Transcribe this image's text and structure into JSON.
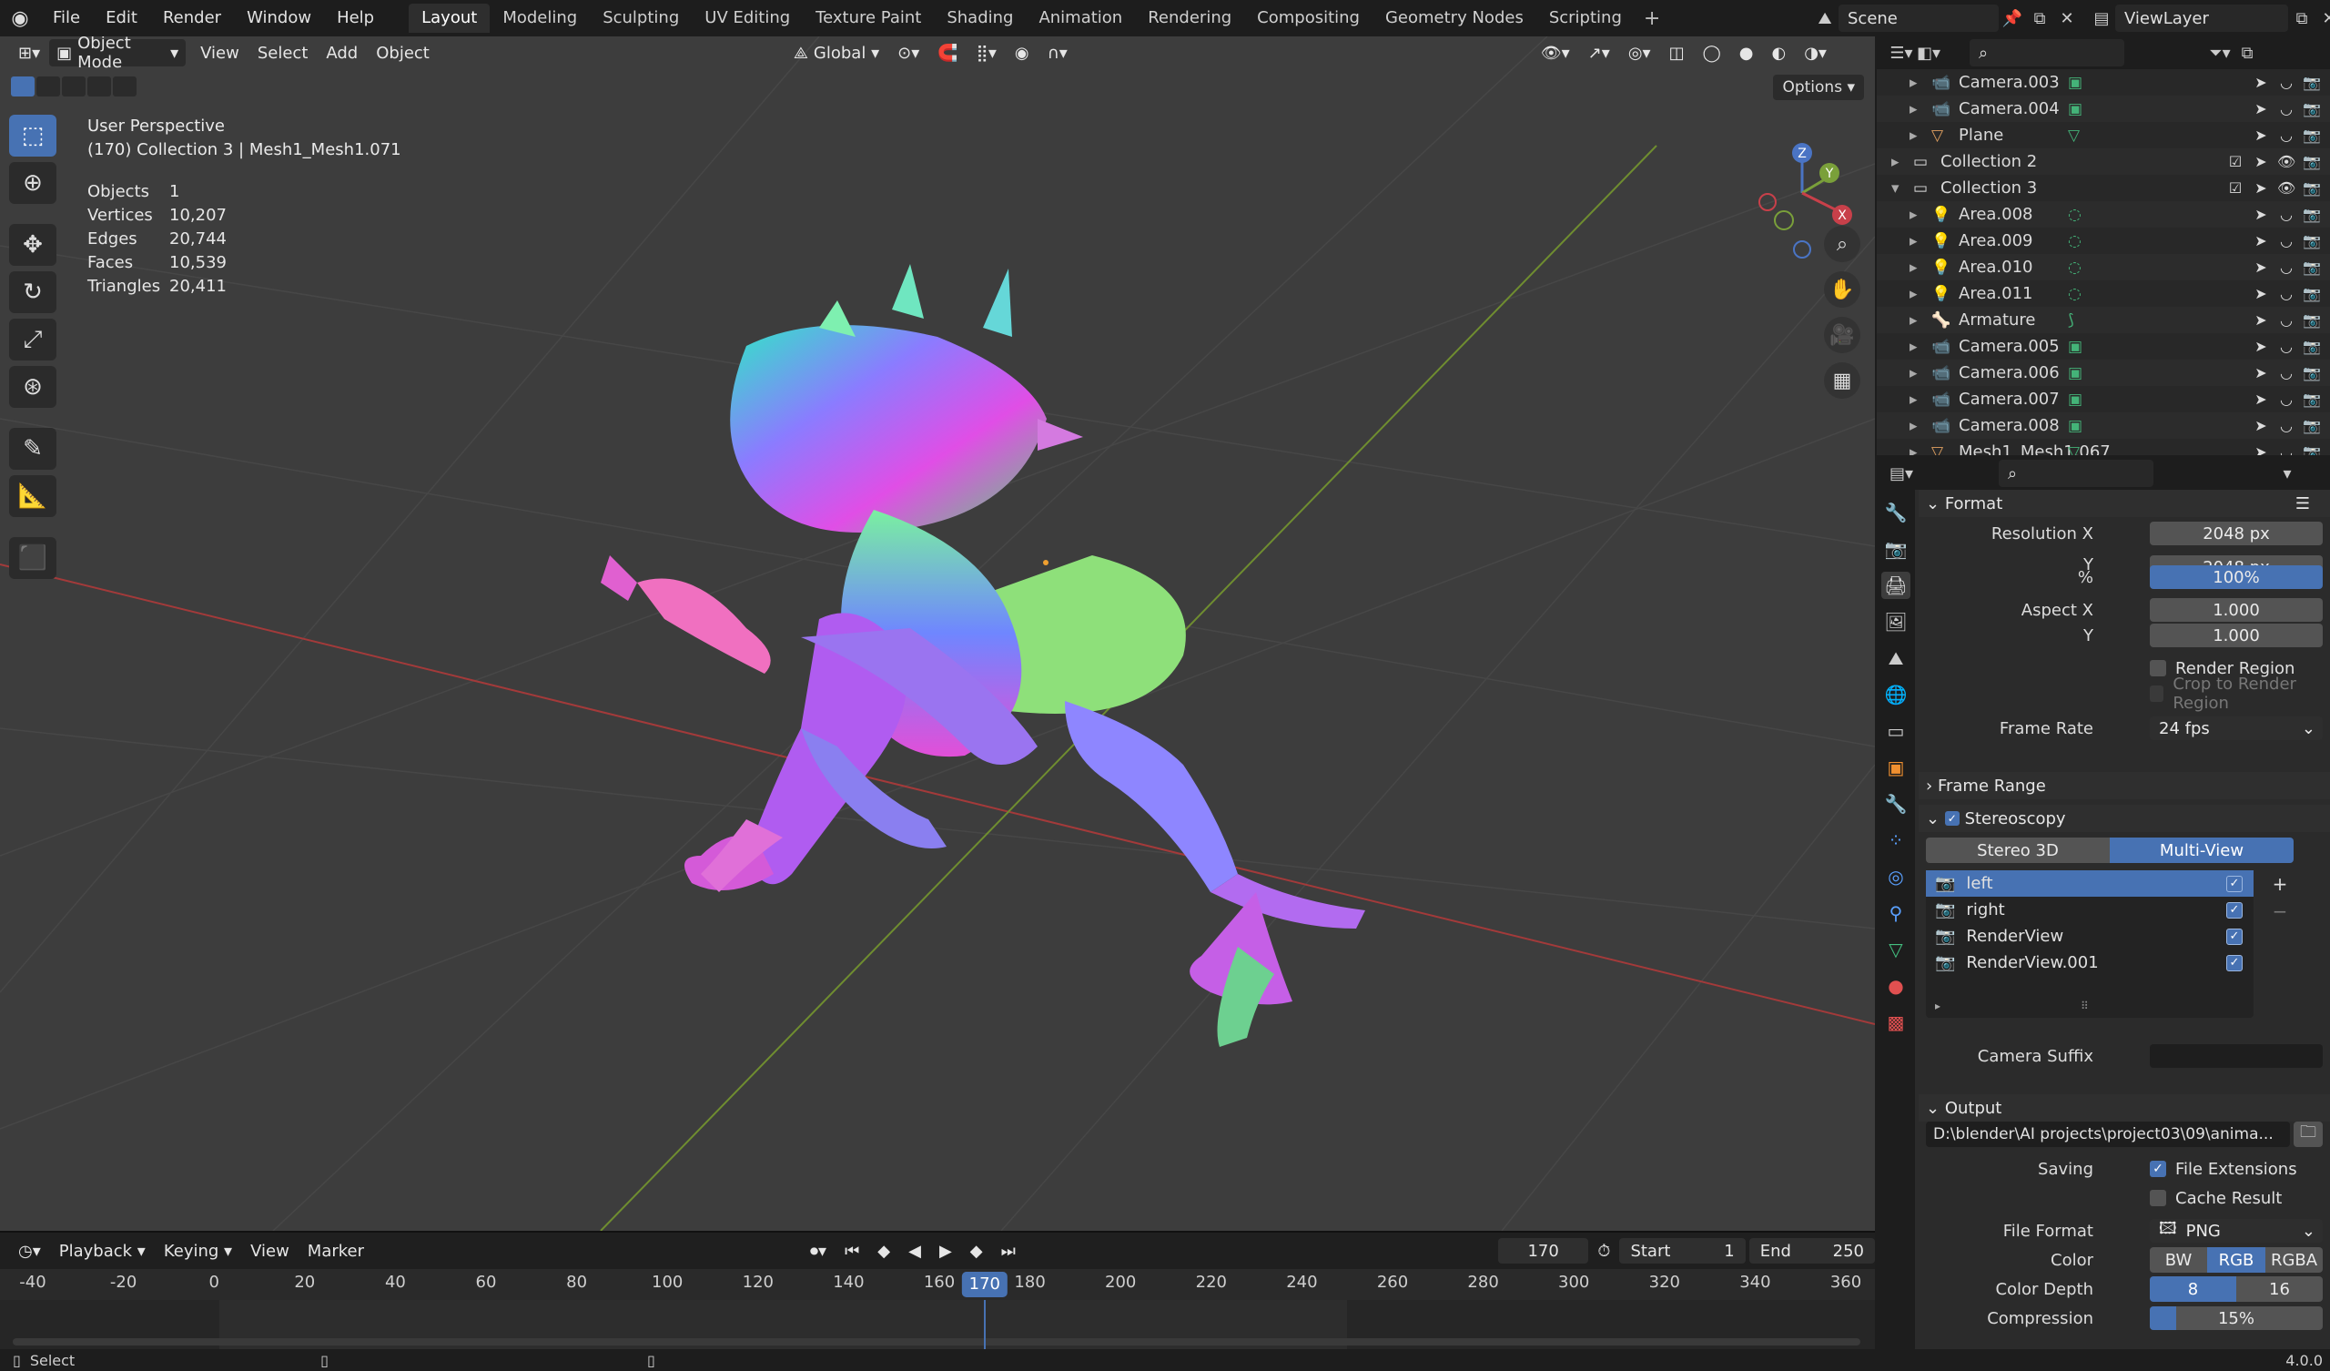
{
  "menu": [
    "File",
    "Edit",
    "Render",
    "Window",
    "Help"
  ],
  "workspaces": [
    "Layout",
    "Modeling",
    "Sculpting",
    "UV Editing",
    "Texture Paint",
    "Shading",
    "Animation",
    "Rendering",
    "Compositing",
    "Geometry Nodes",
    "Scripting"
  ],
  "active_workspace": "Layout",
  "scene_name": "Scene",
  "view_layer": "ViewLayer",
  "viewport": {
    "mode": "Object Mode",
    "menus": [
      "View",
      "Select",
      "Add",
      "Object"
    ],
    "orientation": "Global",
    "options": "Options",
    "title": "User Perspective",
    "subtitle": "(170) Collection 3 | Mesh1_Mesh1.071",
    "stats": [
      {
        "k": "Objects",
        "v": "1"
      },
      {
        "k": "Vertices",
        "v": "10,207"
      },
      {
        "k": "Edges",
        "v": "20,744"
      },
      {
        "k": "Faces",
        "v": "10,539"
      },
      {
        "k": "Triangles",
        "v": "20,411"
      }
    ],
    "gizmo": {
      "x": "X",
      "y": "Y",
      "z": "Z"
    }
  },
  "timeline": {
    "menus": [
      "Playback",
      "Keying",
      "View",
      "Marker"
    ],
    "current": "170",
    "start_label": "Start",
    "start": "1",
    "end_label": "End",
    "end": "250",
    "ticks": [
      "-40",
      "-20",
      "0",
      "20",
      "40",
      "60",
      "80",
      "100",
      "120",
      "140",
      "160",
      "180",
      "200",
      "220",
      "240",
      "260",
      "280",
      "300",
      "320",
      "340",
      "360"
    ]
  },
  "statusbar": {
    "left": "Select",
    "version": "4.0.0"
  },
  "outliner": {
    "rows": [
      {
        "name": "Camera.003",
        "indent": 2,
        "type": "camera"
      },
      {
        "name": "Camera.004",
        "indent": 2,
        "type": "camera"
      },
      {
        "name": "Plane",
        "indent": 2,
        "type": "mesh"
      },
      {
        "name": "Collection 2",
        "indent": 1,
        "type": "collection"
      },
      {
        "name": "Collection 3",
        "indent": 1,
        "type": "collection"
      },
      {
        "name": "Area.008",
        "indent": 2,
        "type": "light"
      },
      {
        "name": "Area.009",
        "indent": 2,
        "type": "light"
      },
      {
        "name": "Area.010",
        "indent": 2,
        "type": "light"
      },
      {
        "name": "Area.011",
        "indent": 2,
        "type": "light"
      },
      {
        "name": "Armature",
        "indent": 2,
        "type": "armature"
      },
      {
        "name": "Camera.005",
        "indent": 2,
        "type": "camera"
      },
      {
        "name": "Camera.006",
        "indent": 2,
        "type": "camera"
      },
      {
        "name": "Camera.007",
        "indent": 2,
        "type": "camera"
      },
      {
        "name": "Camera.008",
        "indent": 2,
        "type": "camera"
      },
      {
        "name": "Mesh1_Mesh1.067",
        "indent": 2,
        "type": "mesh"
      }
    ]
  },
  "properties": {
    "format_panel": "Format",
    "resolution_x_label": "Resolution X",
    "resolution_x": "2048 px",
    "y_label": "Y",
    "resolution_y": "2048 px",
    "percent_label": "%",
    "percent": "100%",
    "aspect_x_label": "Aspect X",
    "aspect_x": "1.000",
    "aspect_y": "1.000",
    "render_region": "Render Region",
    "crop_region": "Crop to Render Region",
    "frame_rate_label": "Frame Rate",
    "frame_rate": "24 fps",
    "frame_range_panel": "Frame Range",
    "stereoscopy_panel": "Stereoscopy",
    "stereo_modes": [
      "Stereo 3D",
      "Multi-View"
    ],
    "views": [
      "left",
      "right",
      "RenderView",
      "RenderView.001"
    ],
    "camera_suffix_label": "Camera Suffix",
    "camera_suffix": "",
    "output_panel": "Output",
    "output_path": "D:\\blender\\AI projects\\project03\\09\\anima...",
    "saving_label": "Saving",
    "file_extensions": "File Extensions",
    "cache_result": "Cache Result",
    "file_format_label": "File Format",
    "file_format": "PNG",
    "color_label": "Color",
    "color_modes": [
      "BW",
      "RGB",
      "RGBA"
    ],
    "color_depth_label": "Color Depth",
    "color_depths": [
      "8",
      "16"
    ],
    "compression_label": "Compression",
    "compression": "15%"
  }
}
